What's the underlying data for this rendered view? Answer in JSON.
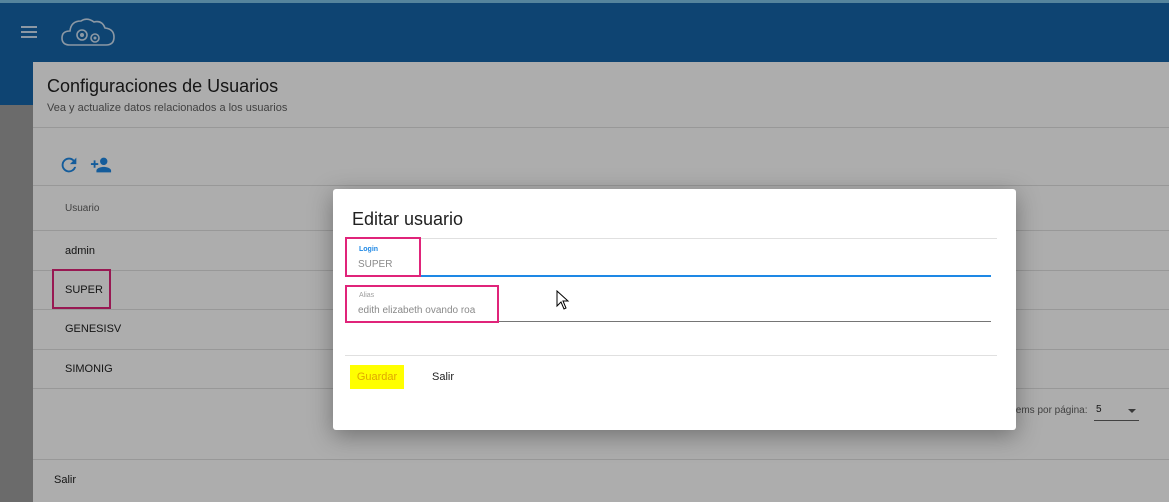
{
  "header": {
    "menu_icon": "hamburger-menu-icon",
    "logo_icon": "cloud-gears-logo"
  },
  "page": {
    "title": "Configuraciones de Usuarios",
    "subtitle": "Vea y actualize datos relacionados a los usuarios"
  },
  "toolbar": {
    "refresh_icon": "refresh-icon",
    "add_user_icon": "person-add-icon"
  },
  "table": {
    "column_header": "Usuario",
    "rows": [
      "admin",
      "SUPER",
      "GENESISV",
      "SIMONIG"
    ],
    "items_per_page_label": "tems por página:",
    "items_per_page_value": "5"
  },
  "footer": {
    "salir_label": "Salir"
  },
  "dialog": {
    "title": "Editar usuario",
    "login_label": "Login",
    "login_value": "SUPER",
    "alias_label": "Alias",
    "alias_value": "edith elizabeth ovando roa",
    "save_label": "Guardar",
    "exit_label": "Salir"
  },
  "colors": {
    "primary": "#1565a8",
    "accent_blue": "#1e88e5",
    "highlight_border": "#e0247a",
    "highlight_fill": "#ffff00"
  }
}
